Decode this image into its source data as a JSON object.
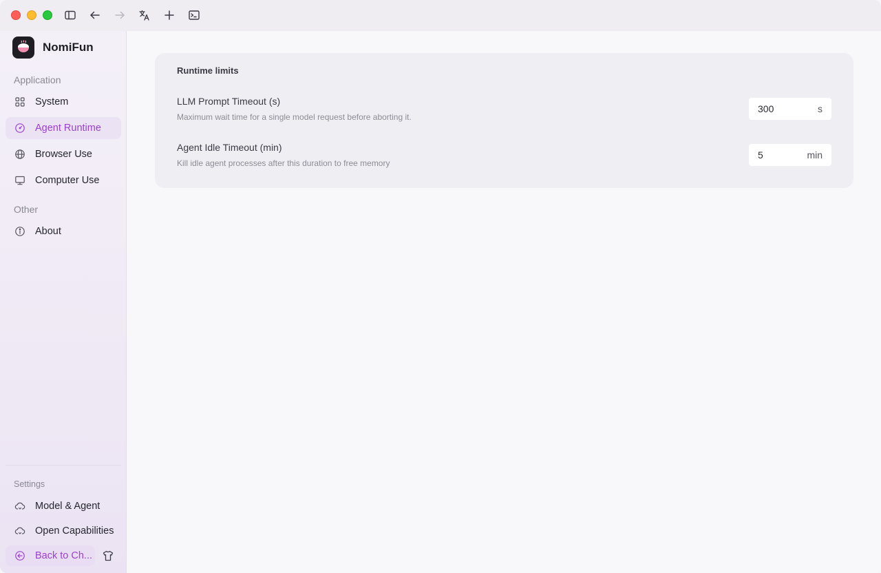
{
  "app": {
    "name": "NomiFun"
  },
  "titlebar": {
    "icons": [
      "sidebar-toggle-icon",
      "arrow-left-icon",
      "arrow-right-icon",
      "translate-icon",
      "plus-icon",
      "terminal-icon"
    ]
  },
  "sidebar": {
    "sections": {
      "application": "Application",
      "other": "Other",
      "settings": "Settings"
    },
    "items": [
      {
        "label": "System",
        "icon": "grid-icon"
      },
      {
        "label": "Agent Runtime",
        "icon": "gauge-icon",
        "active": true
      },
      {
        "label": "Browser Use",
        "icon": "globe-icon"
      },
      {
        "label": "Computer Use",
        "icon": "monitor-icon"
      },
      {
        "label": "About",
        "icon": "info-icon"
      },
      {
        "label": "Model & Agent",
        "icon": "cloud-icon"
      },
      {
        "label": "Open Capabilities",
        "icon": "cloud-icon"
      }
    ],
    "back_label": "Back to Ch...",
    "accent_color": "#9b3fd0"
  },
  "main": {
    "card_title": "Runtime limits",
    "rows": [
      {
        "label": "LLM Prompt Timeout (s)",
        "description": "Maximum wait time for a single model request before aborting it.",
        "value": "300",
        "unit": "s"
      },
      {
        "label": "Agent Idle Timeout (min)",
        "description": "Kill idle agent processes after this duration to free memory",
        "value": "5",
        "unit": "min"
      }
    ]
  }
}
